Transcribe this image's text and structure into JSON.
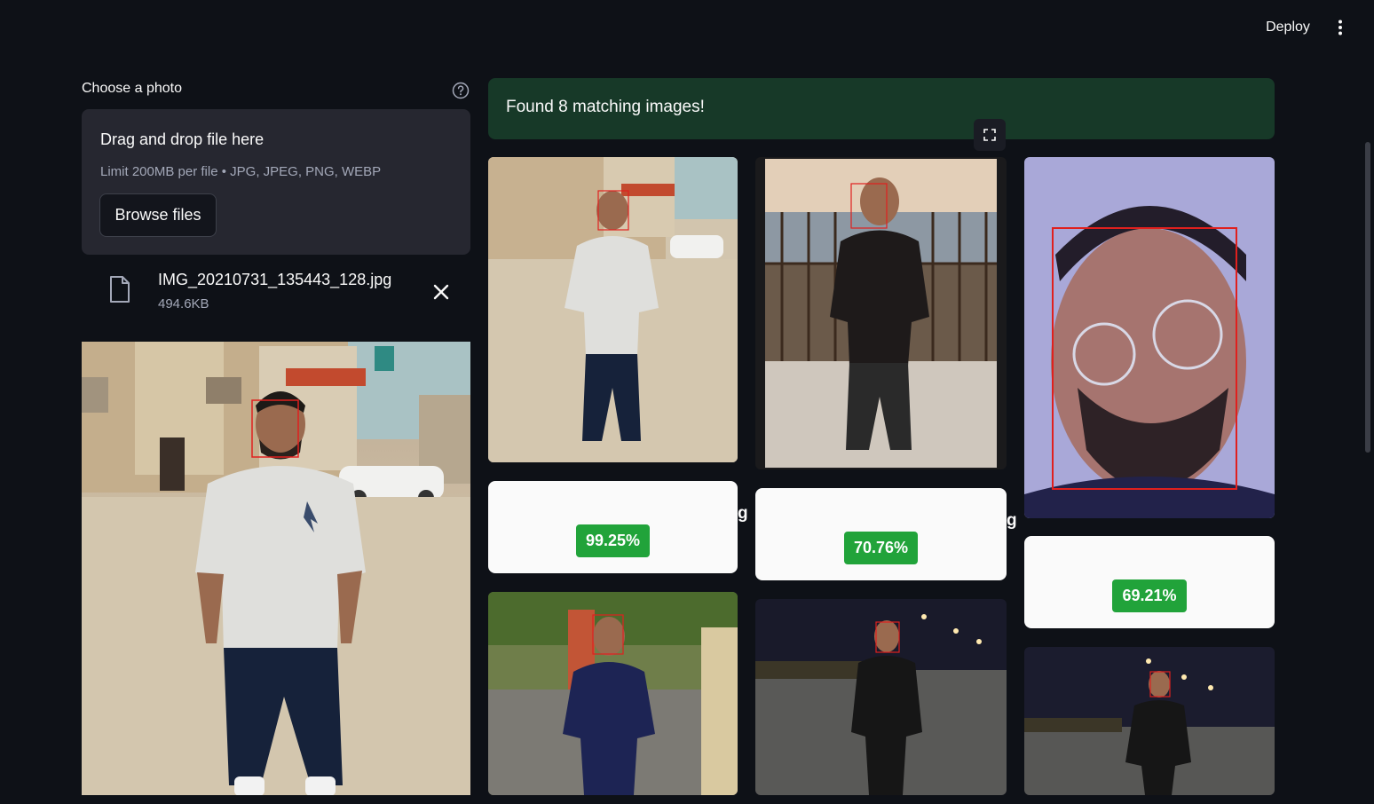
{
  "header": {
    "deploy_label": "Deploy",
    "menu_icon": "vertical-ellipsis-icon"
  },
  "uploader": {
    "label": "Choose a photo",
    "help_icon": "question-circle-icon",
    "dropzone_title": "Drag and drop file here",
    "dropzone_limit": "Limit 200MB per file • JPG, JPEG, PNG, WEBP",
    "browse_label": "Browse files",
    "file": {
      "name": "IMG_20210731_135443_128.jpg",
      "size": "494.6KB",
      "icon": "file-icon",
      "remove_icon": "close-icon"
    }
  },
  "results": {
    "banner_text": "Found 8 matching images!",
    "fullscreen_icon": "fullscreen-icon",
    "scores": [
      "99.25%",
      "70.76%",
      "69.21%"
    ],
    "stray_glyphs": [
      "g",
      "g"
    ]
  },
  "colors": {
    "background": "#0e1117",
    "success_bg": "#173928",
    "badge_green": "#21a33a",
    "dropzone_bg": "#262730",
    "face_box": "#e0201e"
  }
}
